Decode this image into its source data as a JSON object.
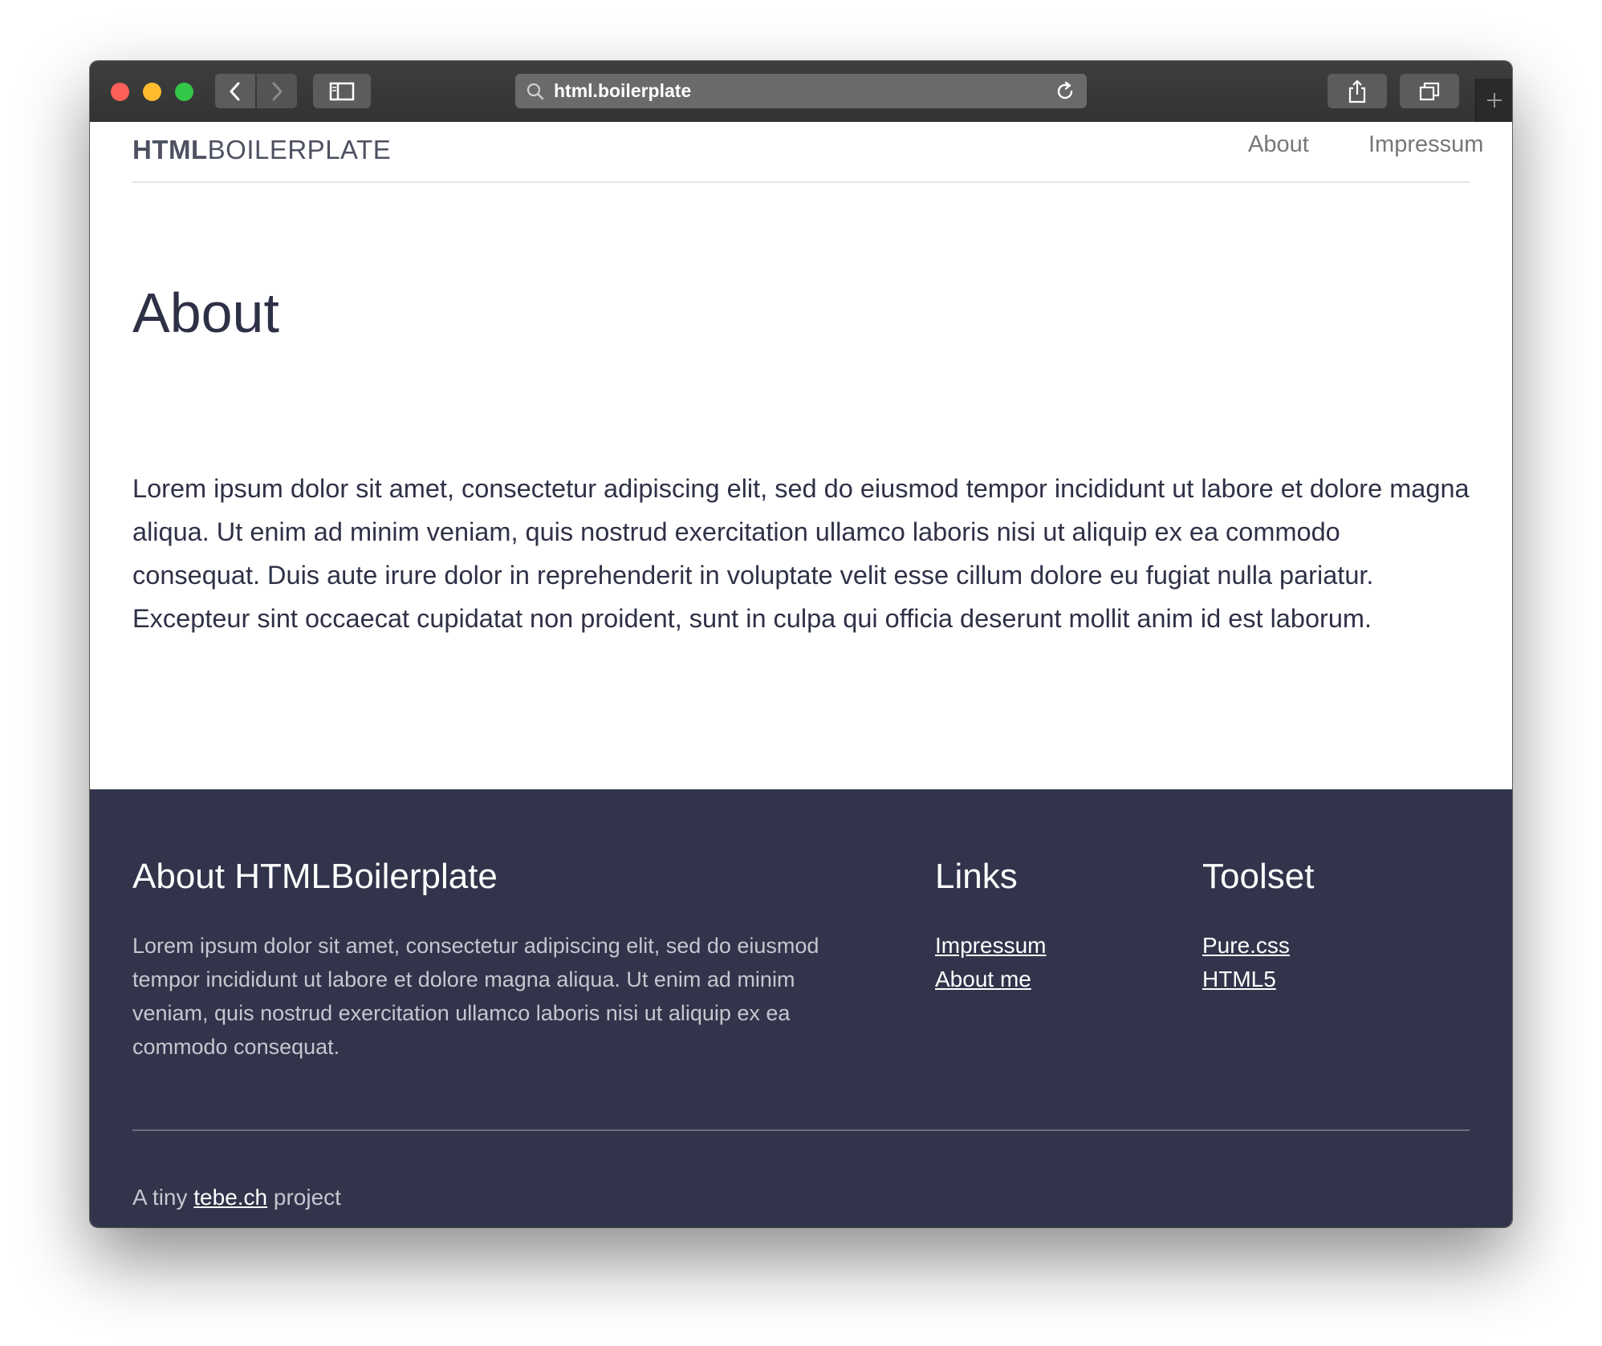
{
  "browser": {
    "url": "html.boilerplate",
    "icons": [
      "back-arrow-icon",
      "forward-arrow-icon",
      "sidebar-icon",
      "search-icon",
      "reload-icon",
      "share-icon",
      "tabs-icon",
      "plus-icon"
    ]
  },
  "header": {
    "brand_bold": "HTML",
    "brand_regular": "BOILERPLATE",
    "nav": [
      {
        "label": "About"
      },
      {
        "label": "Impressum"
      }
    ]
  },
  "main": {
    "title": "About",
    "body": "Lorem ipsum dolor sit amet, consectetur adipiscing elit, sed do eiusmod tempor incididunt ut labore et dolore magna aliqua. Ut enim ad minim veniam, quis nostrud exercitation ullamco laboris nisi ut aliquip ex ea commodo consequat. Duis aute irure dolor in reprehenderit in voluptate velit esse cillum dolore eu fugiat nulla pariatur. Excepteur sint occaecat cupidatat non proident, sunt in culpa qui officia deserunt mollit anim id est laborum."
  },
  "footer": {
    "about": {
      "heading": "About HTMLBoilerplate",
      "text": "Lorem ipsum dolor sit amet, consectetur adipiscing elit, sed do eiusmod tempor incididunt ut labore et dolore magna aliqua. Ut enim ad minim veniam, quis nostrud exercitation ullamco laboris nisi ut aliquip ex ea commodo consequat."
    },
    "links": {
      "heading": "Links",
      "items": [
        {
          "label": "Impressum"
        },
        {
          "label": "About me"
        }
      ]
    },
    "toolset": {
      "heading": "Toolset",
      "items": [
        {
          "label": "Pure.css"
        },
        {
          "label": "HTML5"
        }
      ]
    },
    "credit": {
      "prefix": "A tiny",
      "link": "tebe.ch",
      "suffix": "project"
    }
  },
  "colors": {
    "footer_bg": "#31344a",
    "heading_text": "#2e3146",
    "toolbar_bg": "#3a3a3a"
  }
}
